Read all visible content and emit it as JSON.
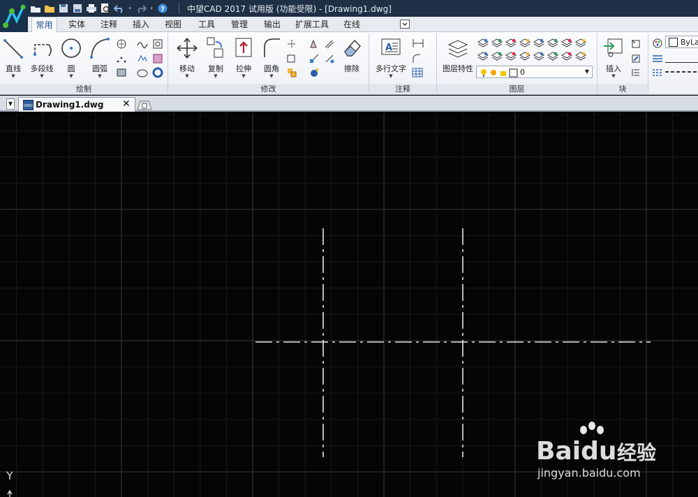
{
  "window": {
    "title": "中望CAD 2017 试用版 (功能受限) - [Drawing1.dwg]"
  },
  "quick_access": {
    "icons": [
      "new-icon",
      "open-icon",
      "save-icon",
      "save-as-icon",
      "print-icon",
      "plot-preview-icon",
      "undo-icon",
      "redo-icon",
      "help-icon"
    ]
  },
  "ribbon": {
    "tabs": [
      "常用",
      "实体",
      "注释",
      "插入",
      "视图",
      "工具",
      "管理",
      "输出",
      "扩展工具",
      "在线"
    ],
    "active_tab": "常用",
    "groups": {
      "draw": {
        "title": "绘制",
        "buttons": [
          "直线",
          "多段线",
          "圆",
          "圆弧"
        ]
      },
      "modify": {
        "title": "修改",
        "buttons": [
          "移动",
          "复制",
          "拉伸",
          "圆角",
          "擦除"
        ]
      },
      "annotation": {
        "title": "注释",
        "buttons": [
          "多行文字"
        ]
      },
      "layers": {
        "title": "图层",
        "buttons": [
          "图层特性"
        ],
        "current_layer": "0"
      },
      "block": {
        "title": "块",
        "buttons": [
          "插入"
        ]
      },
      "properties": {
        "color": "ByLa"
      }
    }
  },
  "document": {
    "tab_label": "Drawing1.dwg",
    "close_glyph": "✕"
  },
  "canvas": {
    "background": "#050505",
    "grid_minor_color": "#1a1a1a",
    "grid_major_color": "#3a3a3a",
    "line_color": "#e6e6e6",
    "y_axis_label": "Y"
  },
  "watermark": {
    "text_latin": "Baidu",
    "text_cn": "经验",
    "url": "jingyan.baidu.com"
  }
}
